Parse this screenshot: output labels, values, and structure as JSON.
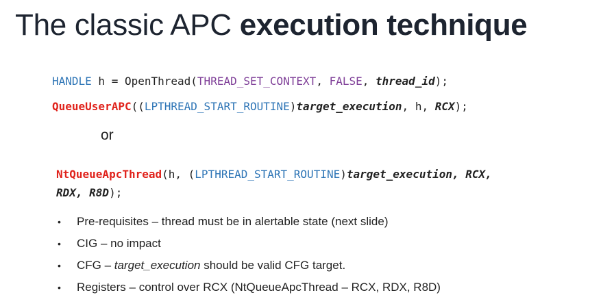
{
  "title": {
    "normal": "The classic APC ",
    "bold": "execution technique"
  },
  "code": {
    "line1": {
      "type": "HANDLE",
      "assign": " h = OpenThread(",
      "arg1": "THREAD_SET_CONTEXT",
      "sep1": ", ",
      "arg2": "FALSE",
      "sep2": ", ",
      "arg3": "thread_id",
      "end": ");"
    },
    "line2": {
      "func": "QueueUserAPC",
      "open": "((",
      "cast": "LPTHREAD_START_ROUTINE",
      "close": ")",
      "target": "target_execution",
      "mid": ", h, ",
      "reg": "RCX",
      "end": ");"
    },
    "or_text": "or",
    "line3": {
      "func": "NtQueueApcThread",
      "open": "(h, (",
      "cast": "LPTHREAD_START_ROUTINE",
      "close": ")",
      "target": "target_execution, RCX,"
    },
    "line4": {
      "regs": "RDX, R8D",
      "end": ");"
    }
  },
  "bullets": [
    {
      "text": "Pre-requisites – thread must be in alertable state (next slide)"
    },
    {
      "text": "CIG – no impact"
    },
    {
      "pre": "CFG – ",
      "italic": "target_execution",
      "post": " should be valid CFG target."
    },
    {
      "text": "Registers – control over RCX (NtQueueApcThread – RCX, RDX, R8D)"
    }
  ],
  "bullet_symbol": "•"
}
